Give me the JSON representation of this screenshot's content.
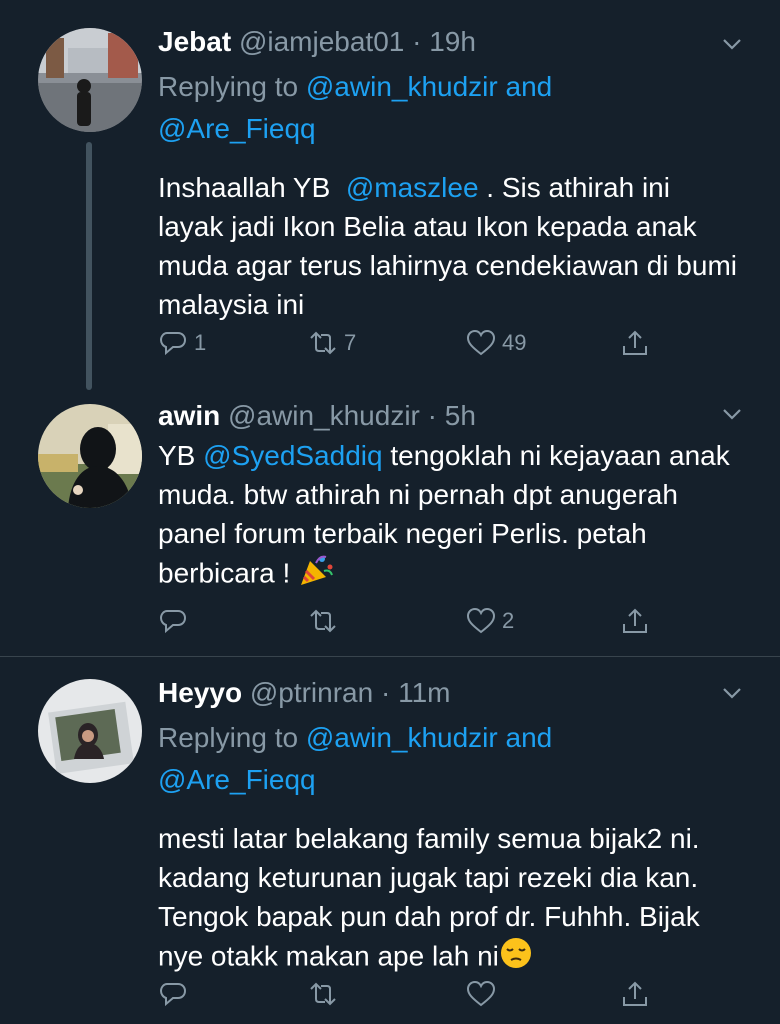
{
  "tweets": [
    {
      "name": "Jebat",
      "handle": "@iamjebat01",
      "time": "19h",
      "replying_prefix": "Replying to ",
      "replying_line1": "@awin_khudzir and",
      "replying_line2": "@Are_Fieqq",
      "text_pre": "Inshaallah YB  ",
      "mention": "@maszlee",
      "text_post": " . Sis athirah ini layak jadi Ikon Belia atau Ikon kepada anak muda agar terus lahirnya cendekiawan di bumi malaysia ini",
      "replies": "1",
      "retweets": "7",
      "likes": "49"
    },
    {
      "name": "awin",
      "handle": "@awin_khudzir",
      "time": "5h",
      "text_pre": "YB ",
      "mention": "@SyedSaddiq",
      "text_post": " tengoklah ni kejayaan anak muda. btw athirah ni pernah dpt anugerah panel forum terbaik negeri Perlis. petah berbicara ! ",
      "emoji": "party-popper",
      "replies": "",
      "retweets": "",
      "likes": "2"
    },
    {
      "name": "Heyyo",
      "handle": "@ptrinran",
      "time": "11m",
      "replying_prefix": "Replying to ",
      "replying_line1": "@awin_khudzir and",
      "replying_line2": "@Are_Fieqq",
      "text": "mesti latar belakang family semua bijak2 ni. kadang keturunan jugak tapi rezeki dia kan. Tengok bapak pun dah prof dr. Fuhhh. Bijak nye otakk makan ape lah ni",
      "emoji": "pensive-face",
      "replies": "",
      "retweets": "",
      "likes": ""
    }
  ],
  "separator": "·",
  "colors": {
    "background": "#15202b",
    "secondary_text": "#8899a6",
    "link": "#1da1f2",
    "divider": "#38444d"
  }
}
